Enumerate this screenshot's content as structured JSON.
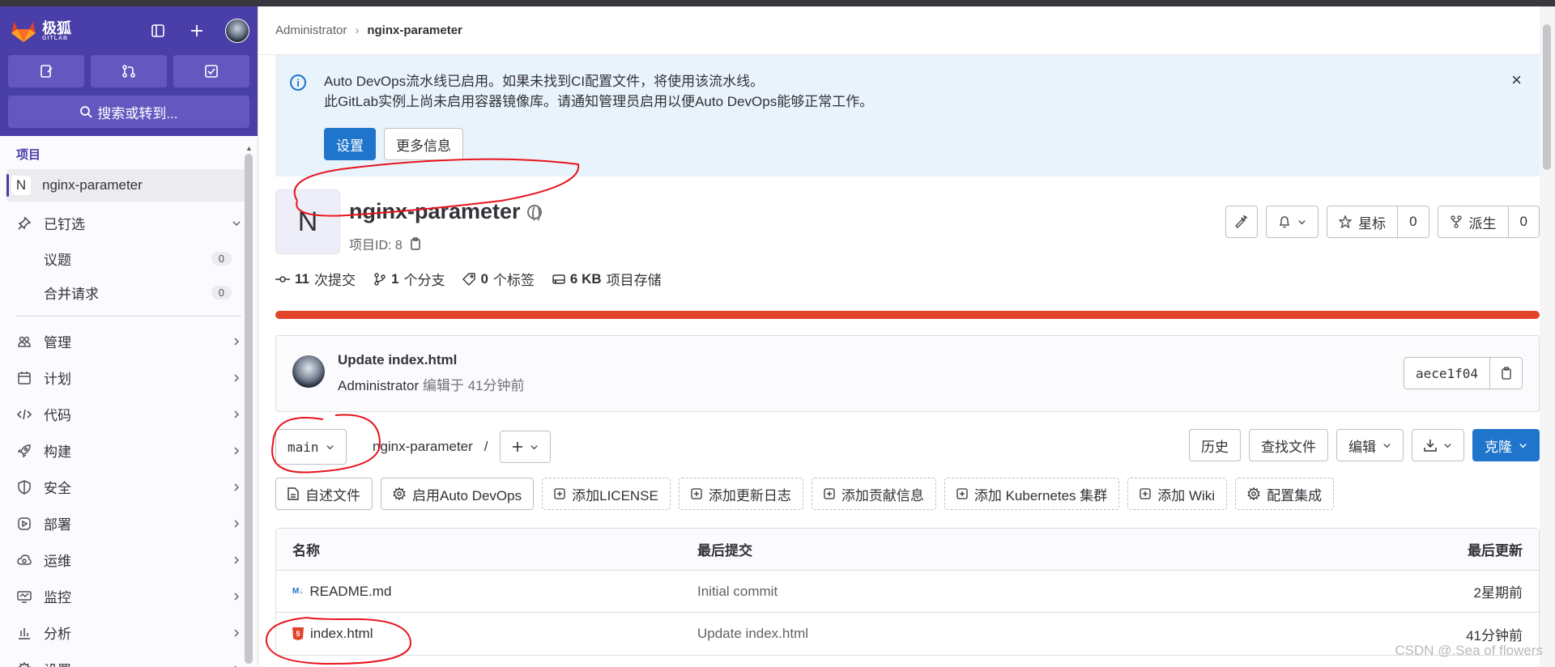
{
  "sidebar": {
    "logo_text": "极狐",
    "logo_sub": "GITLAB",
    "search_label": "搜索或转到...",
    "section_label": "项目",
    "project": {
      "initial": "N",
      "name": "nginx-parameter"
    },
    "pinned": {
      "label": "已钉选",
      "items": [
        {
          "label": "议题",
          "count": "0"
        },
        {
          "label": "合并请求",
          "count": "0"
        }
      ]
    },
    "nav_items": [
      {
        "label": "管理",
        "icon": "users-icon"
      },
      {
        "label": "计划",
        "icon": "calendar-icon"
      },
      {
        "label": "代码",
        "icon": "code-icon"
      },
      {
        "label": "构建",
        "icon": "rocket-icon"
      },
      {
        "label": "安全",
        "icon": "shield-icon"
      },
      {
        "label": "部署",
        "icon": "deploy-icon"
      },
      {
        "label": "运维",
        "icon": "cloud-icon"
      },
      {
        "label": "监控",
        "icon": "monitor-icon"
      },
      {
        "label": "分析",
        "icon": "chart-icon"
      },
      {
        "label": "设置",
        "icon": "gear-icon"
      }
    ]
  },
  "breadcrumb": {
    "parent": "Administrator",
    "current": "nginx-parameter"
  },
  "alert": {
    "line1": "Auto DevOps流水线已启用。如果未找到CI配置文件，将使用该流水线。",
    "line2": "此GitLab实例上尚未启用容器镜像库。请通知管理员启用以便Auto DevOps能够正常工作。",
    "primary_label": "设置",
    "secondary_label": "更多信息"
  },
  "project": {
    "initial": "N",
    "name": "nginx-parameter",
    "id_label": "项目ID: 8",
    "star_label": "星标",
    "star_count": "0",
    "fork_label": "派生",
    "fork_count": "0"
  },
  "stats": [
    {
      "num": "11",
      "label": "次提交"
    },
    {
      "num": "1",
      "label": "个分支"
    },
    {
      "num": "0",
      "label": "个标签"
    },
    {
      "num": "6 KB",
      "label": "项目存储"
    }
  ],
  "commit": {
    "title": "Update index.html",
    "author": "Administrator",
    "meta": "编辑于 41分钟前",
    "sha": "aece1f04"
  },
  "repo": {
    "branch": "main",
    "path": "nginx-parameter",
    "path_sep": "/",
    "history": "历史",
    "find_file": "查找文件",
    "edit": "编辑",
    "clone": "克隆"
  },
  "shortcuts": [
    {
      "label": "自述文件",
      "dashed": false
    },
    {
      "label": "启用Auto DevOps",
      "dashed": false
    },
    {
      "label": "添加LICENSE",
      "dashed": true
    },
    {
      "label": "添加更新日志",
      "dashed": true
    },
    {
      "label": "添加贡献信息",
      "dashed": true
    },
    {
      "label": "添加 Kubernetes 集群",
      "dashed": true
    },
    {
      "label": "添加 Wiki",
      "dashed": true
    },
    {
      "label": "配置集成",
      "dashed": true
    }
  ],
  "files": {
    "headers": {
      "name": "名称",
      "commit": "最后提交",
      "date": "最后更新"
    },
    "rows": [
      {
        "name": "README.md",
        "commit": "Initial commit",
        "date": "2星期前"
      },
      {
        "name": "index.html",
        "commit": "Update index.html",
        "date": "41分钟前"
      }
    ]
  },
  "watermark": "CSDN @.Sea of flowers",
  "colors": {
    "sidebar_header": "#4a3ea8",
    "primary": "#1f75cb",
    "language_bar": "#e24329",
    "annotation": "#e8131c"
  }
}
